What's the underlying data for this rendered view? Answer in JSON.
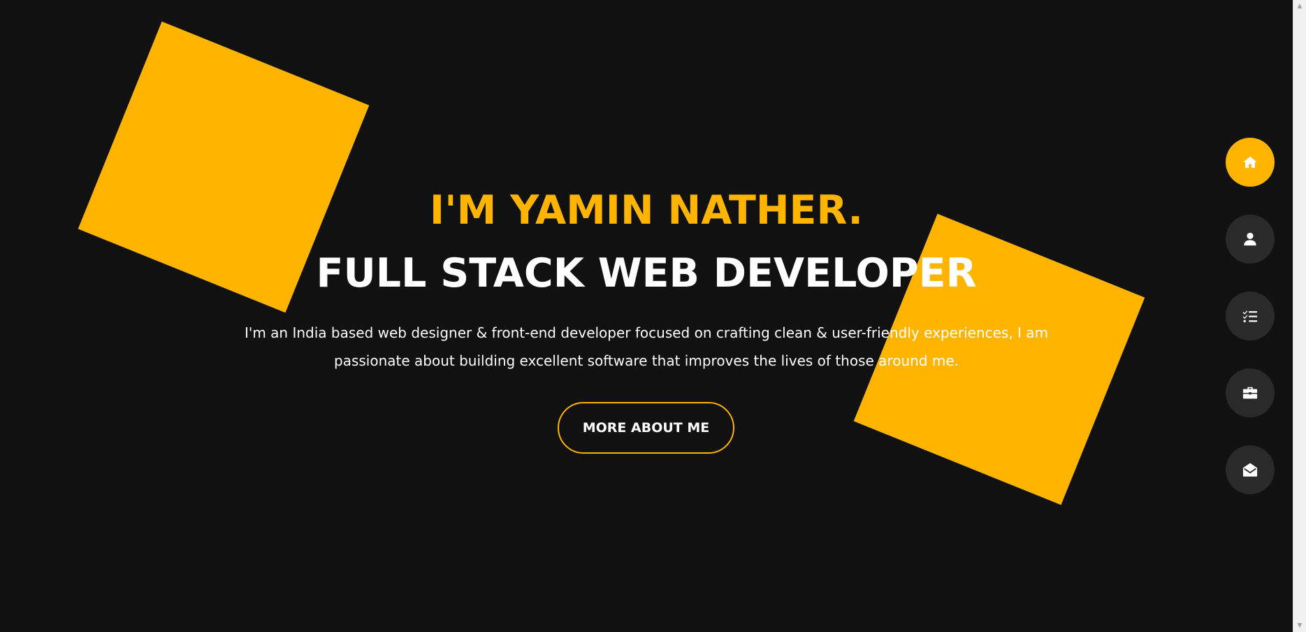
{
  "hero": {
    "name": "I'M YAMIN NATHER.",
    "role": "FULL STACK WEB DEVELOPER",
    "description": "I'm an India based web designer & front-end developer focused on crafting clean & user-friendly experiences, I am passionate about building excellent software that improves the lives of those around me.",
    "button_label": "MORE ABOUT ME"
  },
  "nav": {
    "items": [
      {
        "icon": "home-icon",
        "active": true
      },
      {
        "icon": "user-icon",
        "active": false
      },
      {
        "icon": "list-check-icon",
        "active": false
      },
      {
        "icon": "briefcase-icon",
        "active": false
      },
      {
        "icon": "envelope-open-icon",
        "active": false
      }
    ]
  },
  "colors": {
    "background": "#111111",
    "accent": "#ffb400",
    "nav_button": "#2b2a2a",
    "text": "#ffffff"
  },
  "scrollbar": {
    "up_arrow": "▲",
    "down_arrow": "▼"
  }
}
